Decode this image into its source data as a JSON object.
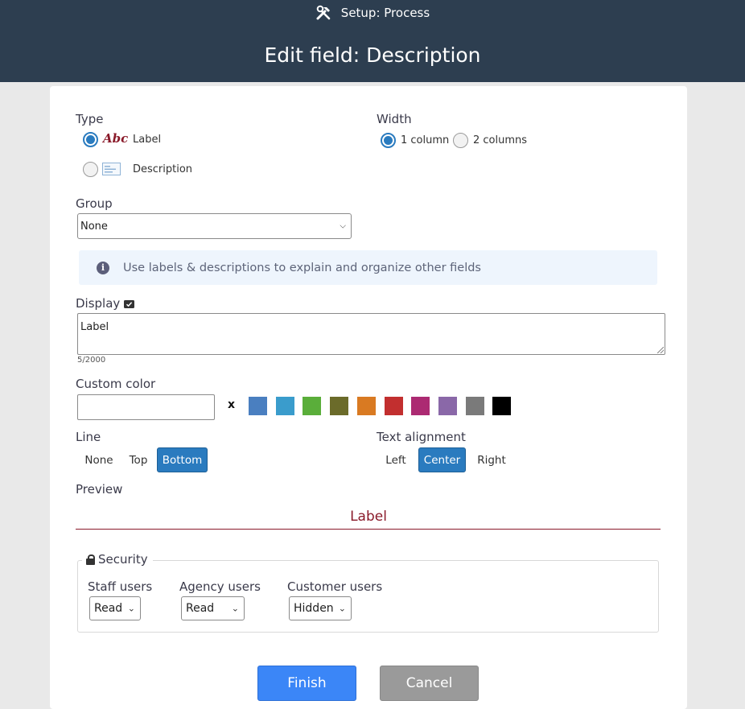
{
  "header": {
    "crumb": "Setup: Process",
    "crumb_icon": "tools-icon",
    "title": "Edit field: Description"
  },
  "type": {
    "label": "Type",
    "options": [
      {
        "icon_text": "Abc",
        "label": "Label",
        "selected": true
      },
      {
        "icon": "description-icon",
        "label": "Description",
        "selected": false
      }
    ]
  },
  "width": {
    "label": "Width",
    "options": [
      {
        "label": "1 column",
        "selected": true
      },
      {
        "label": "2 columns",
        "selected": false
      }
    ]
  },
  "group": {
    "label": "Group",
    "value": "None"
  },
  "info": {
    "text": "Use labels & descriptions to explain and organize other fields"
  },
  "display": {
    "label": "Display",
    "value": "Label",
    "counter": "5/2000"
  },
  "custom_color": {
    "label": "Custom color",
    "value": "",
    "clear": "x",
    "swatches": [
      "#4a7fc0",
      "#3a9ccc",
      "#5aae3a",
      "#6b6b2a",
      "#d97a22",
      "#c22f2f",
      "#ac2a72",
      "#8a68a8",
      "#7a7a7a",
      "#000000"
    ]
  },
  "line": {
    "label": "Line",
    "options": [
      "None",
      "Top",
      "Bottom"
    ],
    "selected": "Bottom"
  },
  "text_alignment": {
    "label": "Text alignment",
    "options": [
      "Left",
      "Center",
      "Right"
    ],
    "selected": "Center"
  },
  "preview": {
    "label": "Preview",
    "text": "Label",
    "color": "#8a1a2a"
  },
  "security": {
    "legend": "Security",
    "staff": {
      "label": "Staff users",
      "value": "Read"
    },
    "agency": {
      "label": "Agency users",
      "value": "Read"
    },
    "customer": {
      "label": "Customer users",
      "value": "Hidden"
    }
  },
  "buttons": {
    "finish": "Finish",
    "cancel": "Cancel"
  }
}
